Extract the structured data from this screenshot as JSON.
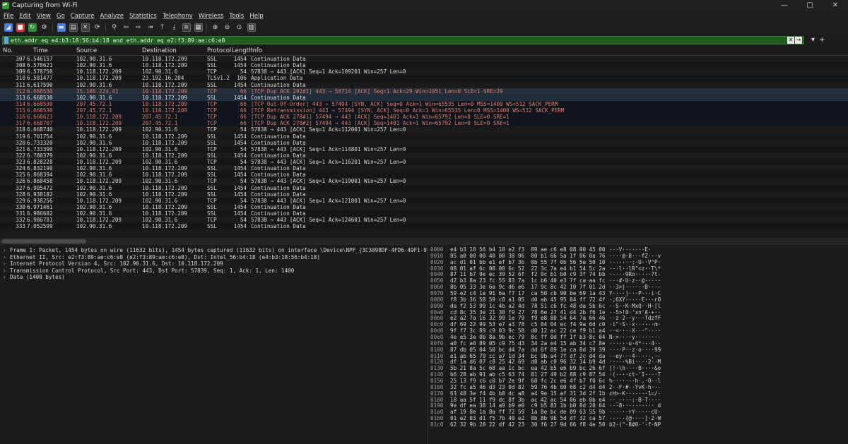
{
  "window": {
    "title": "Capturing from Wi-Fi",
    "controls": [
      "—",
      "▢",
      "✕"
    ]
  },
  "menu": [
    "File",
    "Edit",
    "View",
    "Go",
    "Capture",
    "Analyze",
    "Statistics",
    "Telephony",
    "Wireless",
    "Tools",
    "Help"
  ],
  "filter": {
    "text": "eth.addr eq e4:b3:18:56:b4:18 and eth.addr eq e2:f3:89:ae:c6:e8",
    "clear": "✕",
    "apply": "→",
    "dropdown": "▾",
    "add": "+"
  },
  "columns": {
    "no": "No.",
    "time": "Time",
    "source": "Source",
    "destination": "Destination",
    "protocol": "Protocol",
    "length": "Length",
    "info": "Info"
  },
  "packets": [
    {
      "no": "307",
      "time": "6.546157",
      "src": "102.90.31.6",
      "dst": "10.118.172.209",
      "proto": "SSL",
      "len": "1454",
      "info": "Continuation Data",
      "style": "normal"
    },
    {
      "no": "308",
      "time": "6.578621",
      "src": "102.90.31.6",
      "dst": "10.118.172.209",
      "proto": "SSL",
      "len": "1454",
      "info": "Continuation Data",
      "style": "alt"
    },
    {
      "no": "309",
      "time": "6.578750",
      "src": "10.118.172.209",
      "dst": "102.90.31.6",
      "proto": "TCP",
      "len": "54",
      "info": "57838 → 443 [ACK] Seq=1 Ack=109201 Win=257 Len=0",
      "style": "normal"
    },
    {
      "no": "310",
      "time": "6.581477",
      "src": "10.118.172.209",
      "dst": "23.192.16.204",
      "proto": "TLSv1.2",
      "len": "106",
      "info": "Application Data",
      "style": "alt"
    },
    {
      "no": "311",
      "time": "6.617590",
      "src": "102.90.31.6",
      "dst": "10.118.172.209",
      "proto": "SSL",
      "len": "1454",
      "info": "Continuation Data",
      "style": "normal"
    },
    {
      "no": "312",
      "time": "6.668530",
      "src": "35.186.224.41",
      "dst": "10.118.172.209",
      "proto": "TCP",
      "len": "66",
      "info": "[TCP Dup ACK 292#1] 443 → 58714 [ACK] Seq=1 Ack=29 Win=1051 Len=0 SLE=1 SRE=29",
      "style": "dark"
    },
    {
      "no": "313",
      "time": "6.668530",
      "src": "102.90.31.6",
      "dst": "10.118.172.209",
      "proto": "SSL",
      "len": "1454",
      "info": "Continuation Data",
      "style": "sel"
    },
    {
      "no": "314",
      "time": "6.668530",
      "src": "207.45.72.1",
      "dst": "10.118.172.209",
      "proto": "TCP",
      "len": "66",
      "info": "[TCP Out-Of-Order] 443 → 57494 [SYN, ACK] Seq=0 Ack=1 Win=65535 Len=0 MSS=1400 WS=512 SACK_PERM",
      "style": "tcpbad"
    },
    {
      "no": "315",
      "time": "6.668530",
      "src": "207.45.72.1",
      "dst": "10.118.172.209",
      "proto": "TCP",
      "len": "66",
      "info": "[TCP Retransmission] 443 → 57494 [SYN, ACK] Seq=0 Ack=1 Win=65535 Len=0 MSS=1400 WS=512 SACK_PERM",
      "style": "tcpbad"
    },
    {
      "no": "316",
      "time": "6.668623",
      "src": "10.118.172.209",
      "dst": "207.45.72.1",
      "proto": "TCP",
      "len": "66",
      "info": "[TCP Dup ACK 278#1] 57494 → 443 [ACK] Seq=1401 Ack=1 Win=65792 Len=0 SLE=0 SRE=1",
      "style": "tcpbad"
    },
    {
      "no": "317",
      "time": "6.668707",
      "src": "10.118.172.209",
      "dst": "207.45.72.1",
      "proto": "TCP",
      "len": "66",
      "info": "[TCP Dup ACK 278#2] 57494 → 443 [ACK] Seq=1401 Ack=1 Win=65792 Len=0 SLE=0 SRE=1",
      "style": "tcpbad"
    },
    {
      "no": "318",
      "time": "6.668740",
      "src": "10.118.172.209",
      "dst": "102.90.31.6",
      "proto": "TCP",
      "len": "54",
      "info": "57838 → 443 [ACK] Seq=1 Ack=112001 Win=257 Len=0",
      "style": "normal"
    },
    {
      "no": "319",
      "time": "6.701754",
      "src": "102.90.31.6",
      "dst": "10.118.172.209",
      "proto": "SSL",
      "len": "1454",
      "info": "Continuation Data",
      "style": "alt"
    },
    {
      "no": "320",
      "time": "6.733320",
      "src": "102.90.31.6",
      "dst": "10.118.172.209",
      "proto": "SSL",
      "len": "1454",
      "info": "Continuation Data",
      "style": "normal"
    },
    {
      "no": "321",
      "time": "6.733390",
      "src": "10.118.172.209",
      "dst": "102.90.31.6",
      "proto": "TCP",
      "len": "54",
      "info": "57838 → 443 [ACK] Seq=1 Ack=114801 Win=257 Len=0",
      "style": "alt"
    },
    {
      "no": "322",
      "time": "6.780379",
      "src": "102.90.31.6",
      "dst": "10.118.172.209",
      "proto": "SSL",
      "len": "1454",
      "info": "Continuation Data",
      "style": "normal"
    },
    {
      "no": "323",
      "time": "6.828228",
      "src": "10.118.172.209",
      "dst": "102.90.31.6",
      "proto": "TCP",
      "len": "54",
      "info": "57838 → 443 [ACK] Seq=1 Ack=116201 Win=257 Len=0",
      "style": "alt"
    },
    {
      "no": "324",
      "time": "6.832190",
      "src": "102.90.31.6",
      "dst": "10.118.172.209",
      "proto": "SSL",
      "len": "1454",
      "info": "Continuation Data",
      "style": "normal"
    },
    {
      "no": "325",
      "time": "6.868394",
      "src": "102.90.31.6",
      "dst": "10.118.172.209",
      "proto": "SSL",
      "len": "1454",
      "info": "Continuation Data",
      "style": "alt"
    },
    {
      "no": "326",
      "time": "6.868458",
      "src": "10.118.172.209",
      "dst": "102.90.31.6",
      "proto": "TCP",
      "len": "54",
      "info": "57838 → 443 [ACK] Seq=1 Ack=119001 Win=257 Len=0",
      "style": "normal"
    },
    {
      "no": "327",
      "time": "6.905472",
      "src": "102.90.31.6",
      "dst": "10.118.172.209",
      "proto": "SSL",
      "len": "1454",
      "info": "Continuation Data",
      "style": "alt"
    },
    {
      "no": "328",
      "time": "6.938182",
      "src": "102.90.31.6",
      "dst": "10.118.172.209",
      "proto": "SSL",
      "len": "1454",
      "info": "Continuation Data",
      "style": "normal"
    },
    {
      "no": "329",
      "time": "6.938256",
      "src": "10.118.172.209",
      "dst": "102.90.31.6",
      "proto": "TCP",
      "len": "54",
      "info": "57838 → 443 [ACK] Seq=1 Ack=121801 Win=257 Len=0",
      "style": "alt"
    },
    {
      "no": "330",
      "time": "6.971461",
      "src": "102.90.31.6",
      "dst": "10.118.172.209",
      "proto": "SSL",
      "len": "1454",
      "info": "Continuation Data",
      "style": "normal"
    },
    {
      "no": "331",
      "time": "6.986682",
      "src": "102.90.31.6",
      "dst": "10.118.172.209",
      "proto": "SSL",
      "len": "1454",
      "info": "Continuation Data",
      "style": "alt"
    },
    {
      "no": "332",
      "time": "6.986781",
      "src": "10.118.172.209",
      "dst": "102.90.31.6",
      "proto": "TCP",
      "len": "54",
      "info": "57838 → 443 [ACK] Seq=1 Ack=124601 Win=257 Len=0",
      "style": "normal"
    },
    {
      "no": "333",
      "time": "7.052599",
      "src": "102.90.31.6",
      "dst": "10.118.172.209",
      "proto": "SSL",
      "len": "1454",
      "info": "Continuation Data",
      "style": "alt"
    }
  ],
  "details": [
    "Frame 1: Packet, 1454 bytes on wire (11632 bits), 1454 bytes captured (11632 bits) on interface \\Device\\NPF_{3C3098DF-4FD6-49F1-9D88-",
    "Ethernet II, Src: e2:f3:89:ae:c6:e8 (e2:f3:89:ae:c6:e8), Dst: Intel_56:b4:18 (e4:b3:18:56:b4:18)",
    "Internet Protocol Version 4, Src: 102.90.31.6, Dst: 10.118.172.209",
    "Transmission Control Protocol, Src Port: 443, Dst Port: 57839, Seq: 1, Ack: 1, Len: 1400",
    "Data (1400 bytes)"
  ],
  "bytes": [
    {
      "off": "0000",
      "hex": "e4 b3 18 56 b4 18 e2 f3  89 ae c6 e8 08 00 45 00",
      "ascii": "···V·······E·"
    },
    {
      "off": "0010",
      "hex": "05 a0 00 00 40 00 38 06  00 b1 66 5a 1f 06 0a 76",
      "ascii": "····@·8···fZ···v"
    },
    {
      "off": "0020",
      "hex": "ac d1 01 bb e1 ef b7 3b  0b 55 7f 0b 56 5e 50 10",
      "ascii": "·······;·U··V^P·"
    },
    {
      "off": "0030",
      "hex": "08 01 af 6c 00 00 6c 52  22 3c 7a e4 b1 54 5c 2a",
      "ascii": "···l··lR\"<z··T\\*"
    },
    {
      "off": "0040",
      "hex": "87 11 b7 9e ec 39 52 6f  f2 0c b1 b0 c9 3f 74 bb",
      "ascii": "·····9Ro·····?t·"
    },
    {
      "off": "0050",
      "hex": "d2 b3 8a 23 fc 55 83 7a  1c b6 40 e3 7f ca aa fc",
      "ascii": "···#·U·z··@·····"
    },
    {
      "off": "0060",
      "hex": "8b 05 33 3e 6a 9c d6 e6  17 9c 8c 42 10 7f 01 2d",
      "ascii": "··3>j······B···-"
    },
    {
      "off": "0070",
      "hex": "59 e2 c4 1e 91 6a f7 17  ca 50 cb 90 be 69 1a 43",
      "ascii": "Y····j···P···i·C"
    },
    {
      "off": "0080",
      "hex": "f8 3b 36 58 59 c8 a1 05  d0 ab 45 95 84 ff 72 4f",
      "ascii": "·;6XY·····E···rO"
    },
    {
      "off": "0090",
      "hex": "da f2 53 99 1c 4b a2 4d  78 51 c6 fc 48 da 5b 6c",
      "ascii": "··S··K·MxQ··H·[l"
    },
    {
      "off": "00a0",
      "hex": "cd 8c 35 3e 21 30 f9 27  78 6e 27 41 d4 2b f6 1e",
      "ascii": "··5>!0·'xn'A·+··"
    },
    {
      "off": "00b0",
      "hex": "e2 a2 7a 16 32 99 1e 79  f9 e8 80 54 64 7a 66 46",
      "ascii": "··z·2··y···TdzfF"
    },
    {
      "off": "00c0",
      "hex": "df 69 22 99 53 e7 a3 78  c5 04 04 ec f4 9a 6d c0",
      "ascii": "·i\"·S··x······m·"
    },
    {
      "off": "00d0",
      "hex": "9f f7 3c 89 c9 03 9c 58  d0 12 ac 22 ce f9 b1 a4",
      "ascii": "··<····X···\"····"
    },
    {
      "off": "00e0",
      "hex": "4e e5 3e 0b 8a 9b ec 79  8c ff 0d ff 1f b3 8c 04",
      "ascii": "N·>····y········"
    },
    {
      "off": "00f0",
      "hex": "a0 fc a0 89 05 c9 75 d3  34 2a e4 15 ab 34 c7 8e",
      "ascii": "······u·4*···4··"
    },
    {
      "off": "0100",
      "hex": "87 db 05 04 50 bc d4 7a  dd 6f 09 1e ca 8d 39 39",
      "ascii": "····P··z·o····99"
    },
    {
      "off": "0110",
      "hex": "e1 ab 65 79 cc a7 1d 34  bc 9b a4 7f df 2c d4 da",
      "ascii": "··ey···4·····,··"
    },
    {
      "off": "0120",
      "hex": "df 1a d6 07 c8 25 42 69  d8 ab c0 96 32 14 b9 4d",
      "ascii": "·····%Bi····2··M"
    },
    {
      "off": "0130",
      "hex": "5b 21 8a 5c 68 aa 1c bc  ea 42 b5 e6 b9 bc 26 6f",
      "ascii": "[!·\\h····B····&o"
    },
    {
      "off": "0140",
      "hex": "b6 28 ab 91 ab c5 63 74  81 27 49 b2 88 c9 87 54",
      "ascii": "·(····ct·'I····T"
    },
    {
      "off": "0150",
      "hex": "25 13 f9 c6 c0 b7 2e 9f  68 fc 2c e6 4f b7 f0 6c",
      "ascii": "%·······h·,·O··l"
    },
    {
      "off": "0160",
      "hex": "32 fc a5 46 d3 23 0d 82  59 76 4b 00 68 c2 d4 d4",
      "ascii": "2··F·#··YvK·h···"
    },
    {
      "off": "0170",
      "hex": "63 48 3e f4 4b b8 dc a8  a4 9e 15 af 31 3d 2f 1b",
      "ascii": "cH>·K·······1=/·"
    },
    {
      "off": "0180",
      "hex": "18 aa 5f 11 f9 dc 8f 3b  ac 42 ac 54 06 eb 0b e4",
      "ascii": "··_····;·B·T····"
    },
    {
      "off": "0190",
      "hex": "9e df ea 38 14 a9 b9 e0  c9 b5 83 1b b0 8d 20 64",
      "ascii": "···8·········· d"
    },
    {
      "off": "01a0",
      "hex": "af 19 8e 1a 8a ff 72 59  1a 8e bc de 89 63 55 9b",
      "ascii": "······rY·····cU·"
    },
    {
      "off": "01b0",
      "hex": "01 e2 03 d1 f5 7b 40 e2  0b 8b 9b 5d df 32 ca 57",
      "ascii": "·····{@····]·2·W"
    },
    {
      "off": "01c0",
      "hex": "62 32 9b 28 22 df 42 23  30 f6 27 9d 66 f8 4e 50",
      "ascii": "b2·(\"·B#0·'·f·NP"
    }
  ]
}
